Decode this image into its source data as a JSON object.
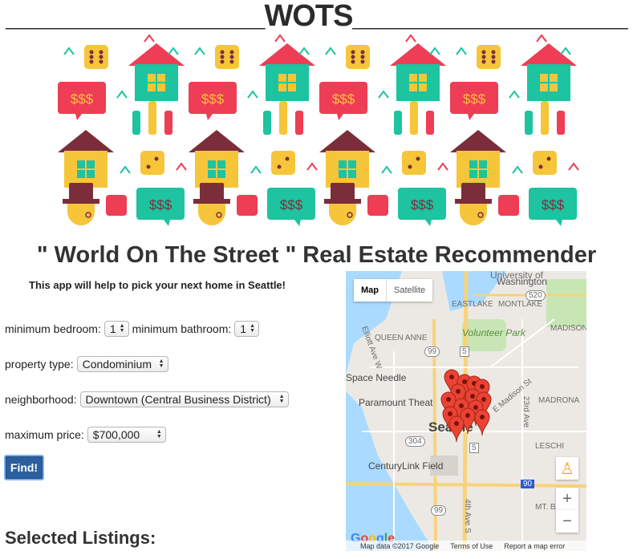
{
  "site": {
    "title": "________________WOTS_________________"
  },
  "app": {
    "heading": "\" World On The Street \" Real Estate Recommender",
    "intro": "This app will help to pick your next home in Seattle!"
  },
  "form": {
    "min_bedroom_label": "minimum bedroom:",
    "min_bedroom_value": "1",
    "min_bathroom_label": "minimum bathroom:",
    "min_bathroom_value": "1",
    "property_type_label": "property type:",
    "property_type_value": "Condominium",
    "neighborhood_label": "neighborhood:",
    "neighborhood_value": "Downtown (Central Business District)",
    "max_price_label": "maximum price:",
    "max_price_value": "$700,000",
    "find_button": "Find!"
  },
  "listings": {
    "heading": "Selected Listings:"
  },
  "map": {
    "type_map": "Map",
    "type_satellite": "Satellite",
    "labels": {
      "university": "University of",
      "washington": "Washington",
      "eastlake": "EASTLAKE",
      "montlake": "MONTLAKE",
      "volunteer_park": "Volunteer Park",
      "madison": "MADISON",
      "queen_anne": "QUEEN ANNE",
      "elliott": "Elliott Ave W",
      "space_needle": "Space Needle",
      "paramount": "Paramount Theat",
      "e_madison": "E Madison St",
      "madrona": "MADRONA",
      "seattle": "Seattle",
      "leschi": "LESCHI",
      "centurylink": "CenturyLink Field",
      "mt_baker": "MT. BAK",
      "ave_23": "23rd Ave",
      "ave_4": "4th Ave S"
    },
    "shields": {
      "i5": "5",
      "r99": "99",
      "r99b": "99",
      "r304": "304",
      "i90": "90",
      "r520": "520",
      "i5b": "5"
    },
    "footer": {
      "data": "Map data ©2017 Google",
      "terms": "Terms of Use",
      "report": "Report a map error"
    },
    "google": "Google",
    "zoom_in": "+",
    "zoom_out": "−",
    "marker_count": 14
  },
  "colors": {
    "red": "#ee3d54",
    "teal": "#1ec3a0",
    "yellow": "#f6c53a",
    "maroon": "#7b2e3a",
    "button": "#2b5f9e"
  }
}
